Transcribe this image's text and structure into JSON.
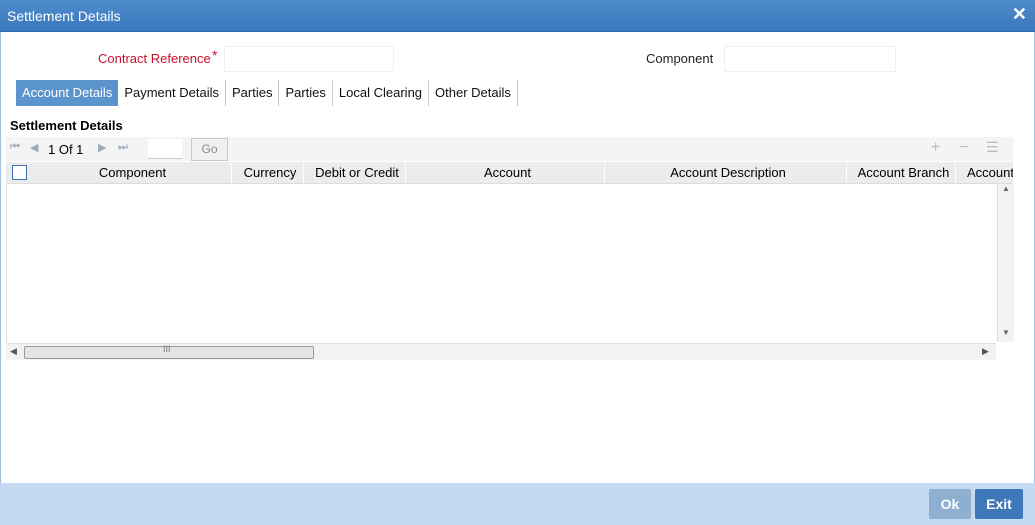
{
  "window": {
    "title": "Settlement Details",
    "close_icon": "close-icon"
  },
  "form": {
    "contract_reference_label": "Contract Reference",
    "required_marker": "*",
    "contract_reference_value": "",
    "component_label": "Component",
    "component_value": ""
  },
  "tabs": [
    {
      "label": "Account Details",
      "active": true
    },
    {
      "label": "Payment Details",
      "active": false
    },
    {
      "label": "Parties",
      "active": false
    },
    {
      "label": "Parties",
      "active": false
    },
    {
      "label": "Local Clearing",
      "active": false
    },
    {
      "label": "Other Details",
      "active": false
    }
  ],
  "section": {
    "title": "Settlement Details"
  },
  "grid": {
    "pagination": {
      "text": "1 Of 1",
      "page_input": "",
      "go_label": "Go"
    },
    "columns": [
      "Component",
      "Currency",
      "Debit or Credit",
      "Account",
      "Account Description",
      "Account Branch",
      "Account"
    ],
    "rows": [],
    "hscroll_grip": "III"
  },
  "footer": {
    "ok_label": "Ok",
    "exit_label": "Exit"
  },
  "colors": {
    "titlebar": "#3b78bc",
    "active_tab": "#5b93cc",
    "required": "#c8102e",
    "footer": "#c5daf0",
    "exit_button": "#3f78b8",
    "ok_button": "#8fafd0"
  }
}
